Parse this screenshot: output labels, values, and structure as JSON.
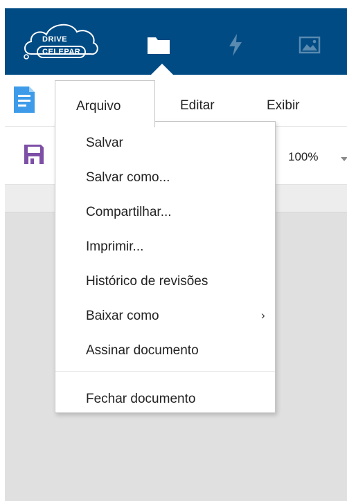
{
  "brand": {
    "logo_line1": "DRIVE",
    "logo_line2": "CELEPAR"
  },
  "nav_icons": [
    "folder-icon",
    "lightning-icon",
    "image-icon"
  ],
  "menubar": {
    "items": [
      "Arquivo",
      "Editar",
      "Exibir"
    ]
  },
  "toolbar": {
    "zoom_label": "100%"
  },
  "file_menu": {
    "items": [
      "Salvar",
      "Salvar como...",
      "Compartilhar...",
      "Imprimir...",
      "Histórico de revisões",
      "Baixar como",
      "Assinar documento",
      "Fechar documento"
    ],
    "submenu_arrow": "›"
  },
  "colors": {
    "topbar": "#004b84",
    "doc_icon": "#3d9be9",
    "save_icon": "#7d4fa6",
    "canvas": "#e0e0e0"
  }
}
